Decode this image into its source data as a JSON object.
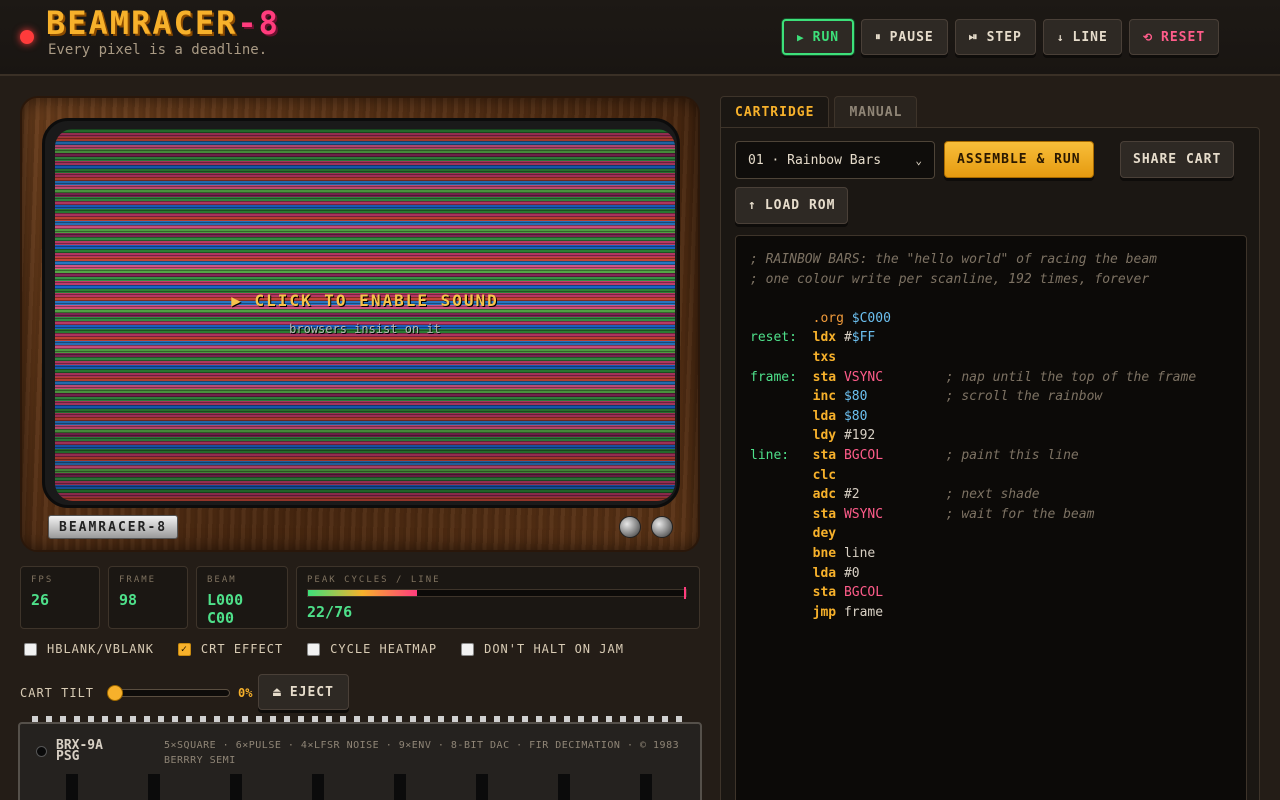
{
  "header": {
    "brand_main": "BEAMRACER",
    "brand_suffix": "-8",
    "tagline": "Every pixel is a deadline.",
    "buttons": {
      "run": "RUN",
      "pause": "PAUSE",
      "step": "STEP",
      "line": "LINE",
      "reset": "RESET"
    }
  },
  "tv": {
    "screen_message": "CLICK TO ENABLE SOUND",
    "screen_sub": "browsers insist on it",
    "badge": "BEAMRACER-8"
  },
  "stats": {
    "fps": {
      "label": "FPS",
      "value": "26"
    },
    "frame": {
      "label": "FRAME",
      "value": "98"
    },
    "beam": {
      "label": "BEAM",
      "value": "L000 C00"
    },
    "peak": {
      "label": "PEAK CYCLES / LINE",
      "value": "22/76",
      "fill": 0.2895
    }
  },
  "options": {
    "hblank": {
      "label": "HBLANK/VBLANK",
      "checked": false
    },
    "crt": {
      "label": "CRT EFFECT",
      "checked": true
    },
    "heatmap": {
      "label": "CYCLE HEATMAP",
      "checked": false
    },
    "nohalt": {
      "label": "DON'T HALT ON JAM",
      "checked": false
    }
  },
  "tilt": {
    "label": "CART TILT",
    "value": "0%",
    "level": 0
  },
  "eject_label": "EJECT",
  "chip": {
    "name": "BRX-9A PSG",
    "spec": "5×SQUARE · 6×PULSE · 4×LFSR NOISE · 9×ENV · 8-BIT DAC · FIR DECIMATION · © 1983 BERRRY SEMI"
  },
  "panel": {
    "tabs": [
      "CARTRIDGE",
      "MANUAL"
    ],
    "cart_select": "01 · Rainbow Bars",
    "assemble_label": "ASSEMBLE & RUN",
    "share_label": "SHARE CART",
    "load_label": "LOAD ROM"
  },
  "code": {
    "comment1": "; RAINBOW BARS: the \"hello world\" of racing the beam",
    "comment2": "; one colour write per scanline, 192 times, forever",
    "lines": [
      {
        "label": "",
        "op": ".org",
        "arg_pre": "",
        "arg": "$C000",
        "arg_kind": "num",
        "comment": ""
      },
      {
        "label": "reset:",
        "op": "ldx",
        "arg_pre": "#",
        "arg": "$FF",
        "arg_kind": "num",
        "comment": ""
      },
      {
        "label": "",
        "op": "txs",
        "arg_pre": "",
        "arg": "",
        "arg_kind": "plain",
        "comment": ""
      },
      {
        "label": "frame:",
        "op": "sta",
        "arg_pre": "",
        "arg": "VSYNC",
        "arg_kind": "sym",
        "comment": "; nap until the top of the frame"
      },
      {
        "label": "",
        "op": "inc",
        "arg_pre": "",
        "arg": "$80",
        "arg_kind": "num",
        "comment": "; scroll the rainbow"
      },
      {
        "label": "",
        "op": "lda",
        "arg_pre": "",
        "arg": "$80",
        "arg_kind": "num",
        "comment": ""
      },
      {
        "label": "",
        "op": "ldy",
        "arg_pre": "#",
        "arg": "192",
        "arg_kind": "plain",
        "comment": ""
      },
      {
        "label": "line:",
        "op": "sta",
        "arg_pre": "",
        "arg": "BGCOL",
        "arg_kind": "sym",
        "comment": "; paint this line"
      },
      {
        "label": "",
        "op": "clc",
        "arg_pre": "",
        "arg": "",
        "arg_kind": "plain",
        "comment": ""
      },
      {
        "label": "",
        "op": "adc",
        "arg_pre": "#",
        "arg": "2",
        "arg_kind": "plain",
        "comment": "; next shade"
      },
      {
        "label": "",
        "op": "sta",
        "arg_pre": "",
        "arg": "WSYNC",
        "arg_kind": "sym",
        "comment": "; wait for the beam"
      },
      {
        "label": "",
        "op": "dey",
        "arg_pre": "",
        "arg": "",
        "arg_kind": "plain",
        "comment": ""
      },
      {
        "label": "",
        "op": "bne",
        "arg_pre": "",
        "arg": "line",
        "arg_kind": "plain",
        "comment": ""
      },
      {
        "label": "",
        "op": "lda",
        "arg_pre": "#",
        "arg": "0",
        "arg_kind": "plain",
        "comment": ""
      },
      {
        "label": "",
        "op": "sta",
        "arg_pre": "",
        "arg": "BGCOL",
        "arg_kind": "sym",
        "comment": ""
      },
      {
        "label": "",
        "op": "jmp",
        "arg_pre": "",
        "arg": "frame",
        "arg_kind": "plain",
        "comment": ""
      }
    ]
  },
  "icons": {
    "run": "play-icon",
    "pause": "pause-icon",
    "step": "step-icon",
    "line": "down-arrow-icon",
    "reset": "reset-icon",
    "load": "up-arrow-icon",
    "eject": "eject-icon"
  },
  "colors": {
    "accent": "#f7b12b",
    "run": "#3de07a",
    "danger": "#ff3c7d"
  }
}
